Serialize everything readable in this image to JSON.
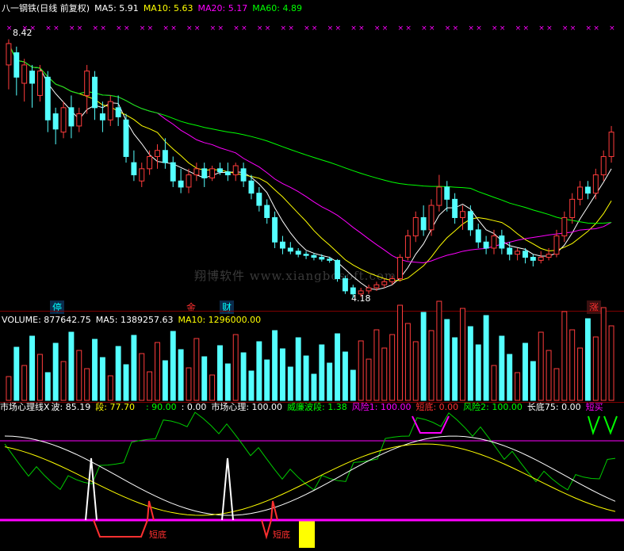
{
  "price_header": {
    "title": "八一钢铁(日线 前复权)",
    "ma5": "MA5: 5.91",
    "ma10": "MA10: 5.63",
    "ma20": "MA20: 5.17",
    "ma60": "MA60: 4.89",
    "colors": {
      "title": "#ffffff",
      "ma5": "#ffffff",
      "ma10": "#ffff00",
      "ma20": "#ff00ff",
      "ma60": "#00ff00"
    }
  },
  "price_labels": {
    "high": "8.42",
    "low": "4.18"
  },
  "badges": {
    "ting": "停",
    "jin": "金",
    "cai": "财",
    "zhang": "涨"
  },
  "watermark": "翔博软件 www.xiangbosoft.com",
  "volume_header": {
    "volume": "VOLUME: 877642.75",
    "ma5": "MA5: 1389257.63",
    "ma10": "MA10: 1296000.00"
  },
  "indicator_header": {
    "name": "市场心理线X",
    "bo": "波: 85.19",
    "duan": "段: 77.70",
    "level90": ": 90.00",
    "level0": ": 0.00",
    "xinli": "市场心理: 100.00",
    "weilian": "威廉波段: 1.38",
    "risk1": "风险1: 100.00",
    "duandi": "短底: 0.00",
    "risk2": "风险2: 100.00",
    "changdi": "长底75: 0.00",
    "duanmai": "短买"
  },
  "indicator_labels": {
    "short_bottom_1": "短底",
    "short_bottom_2": "短底"
  },
  "chart_data": {
    "type": "candlestick",
    "markers_top": "×",
    "candles": [
      [
        8.0,
        8.35,
        8.42,
        7.6
      ],
      [
        8.2,
        7.8,
        8.3,
        7.5
      ],
      [
        7.7,
        8.0,
        8.1,
        7.4
      ],
      [
        7.9,
        7.7,
        8.0,
        7.3
      ],
      [
        7.5,
        7.9,
        8.0,
        7.4
      ],
      [
        7.8,
        7.1,
        7.9,
        6.9
      ],
      [
        7.2,
        6.95,
        7.3,
        6.7
      ],
      [
        6.9,
        7.3,
        7.4,
        6.8
      ],
      [
        7.3,
        7.0,
        7.5,
        6.8
      ],
      [
        7.0,
        7.2,
        7.3,
        6.9
      ],
      [
        7.5,
        7.9,
        8.0,
        7.2
      ],
      [
        7.8,
        7.3,
        7.9,
        7.1
      ],
      [
        7.2,
        7.1,
        7.4,
        6.9
      ],
      [
        7.1,
        7.4,
        7.5,
        7.0
      ],
      [
        7.3,
        7.15,
        7.5,
        7.0
      ],
      [
        7.1,
        6.5,
        7.2,
        6.4
      ],
      [
        6.4,
        6.2,
        6.6,
        6.1
      ],
      [
        6.1,
        6.3,
        6.4,
        6.0
      ],
      [
        6.3,
        6.5,
        6.6,
        6.2
      ],
      [
        6.5,
        6.6,
        6.7,
        6.3
      ],
      [
        6.6,
        6.4,
        6.8,
        6.3
      ],
      [
        6.4,
        6.1,
        6.5,
        6.0
      ],
      [
        6.1,
        6.0,
        6.3,
        5.9
      ],
      [
        6.0,
        6.2,
        6.3,
        5.9
      ],
      [
        6.2,
        6.3,
        6.4,
        6.1
      ],
      [
        6.3,
        6.15,
        6.4,
        6.0
      ],
      [
        6.15,
        6.3,
        6.35,
        6.1
      ],
      [
        6.3,
        6.25,
        6.4,
        6.2
      ],
      [
        6.25,
        6.2,
        6.4,
        6.1
      ],
      [
        6.2,
        6.35,
        6.4,
        6.1
      ],
      [
        6.3,
        6.1,
        6.4,
        6.0
      ],
      [
        6.1,
        5.9,
        6.2,
        5.8
      ],
      [
        5.9,
        5.7,
        6.0,
        5.6
      ],
      [
        5.7,
        5.5,
        5.8,
        5.4
      ],
      [
        5.5,
        5.1,
        5.6,
        5.0
      ],
      [
        5.1,
        5.0,
        5.2,
        4.9
      ],
      [
        5.0,
        4.95,
        5.1,
        4.9
      ],
      [
        4.95,
        4.9,
        5.0,
        4.85
      ],
      [
        4.9,
        4.88,
        4.95,
        4.82
      ],
      [
        4.88,
        4.85,
        4.92,
        4.8
      ],
      [
        4.85,
        4.82,
        4.9,
        4.78
      ],
      [
        4.82,
        4.8,
        4.86,
        4.76
      ],
      [
        4.8,
        4.5,
        4.82,
        4.45
      ],
      [
        4.5,
        4.3,
        4.55,
        4.25
      ],
      [
        4.35,
        4.25,
        4.4,
        4.18
      ],
      [
        4.25,
        4.3,
        4.35,
        4.2
      ],
      [
        4.3,
        4.35,
        4.4,
        4.25
      ],
      [
        4.35,
        4.4,
        4.45,
        4.3
      ],
      [
        4.4,
        4.45,
        4.5,
        4.35
      ],
      [
        4.45,
        4.5,
        4.55,
        4.4
      ],
      [
        4.5,
        4.85,
        4.9,
        4.45
      ],
      [
        4.85,
        5.2,
        5.3,
        4.8
      ],
      [
        5.2,
        5.5,
        5.6,
        5.1
      ],
      [
        5.5,
        5.3,
        5.7,
        5.2
      ],
      [
        5.3,
        5.7,
        5.8,
        5.2
      ],
      [
        5.7,
        6.0,
        6.2,
        5.6
      ],
      [
        6.0,
        5.8,
        6.1,
        5.6
      ],
      [
        5.8,
        5.5,
        5.9,
        5.4
      ],
      [
        5.5,
        5.6,
        5.7,
        5.3
      ],
      [
        5.6,
        5.3,
        5.7,
        5.2
      ],
      [
        5.3,
        5.1,
        5.4,
        5.0
      ],
      [
        5.1,
        5.0,
        5.2,
        4.9
      ],
      [
        5.0,
        5.2,
        5.3,
        4.9
      ],
      [
        5.2,
        5.0,
        5.3,
        4.9
      ],
      [
        5.0,
        4.9,
        5.1,
        4.8
      ],
      [
        4.9,
        4.95,
        5.0,
        4.8
      ],
      [
        4.95,
        4.85,
        5.0,
        4.75
      ],
      [
        4.85,
        4.8,
        4.9,
        4.7
      ],
      [
        4.8,
        4.85,
        4.95,
        4.75
      ],
      [
        4.85,
        4.9,
        5.0,
        4.8
      ],
      [
        4.9,
        5.2,
        5.3,
        4.85
      ],
      [
        5.2,
        5.5,
        5.6,
        5.1
      ],
      [
        5.5,
        5.8,
        5.9,
        5.4
      ],
      [
        5.8,
        6.0,
        6.1,
        5.7
      ],
      [
        6.0,
        5.9,
        6.1,
        5.8
      ],
      [
        5.9,
        6.2,
        6.3,
        5.8
      ],
      [
        6.2,
        6.5,
        6.6,
        6.1
      ],
      [
        6.5,
        6.9,
        7.0,
        6.4
      ]
    ],
    "ylim": [
      4.0,
      8.7
    ]
  }
}
